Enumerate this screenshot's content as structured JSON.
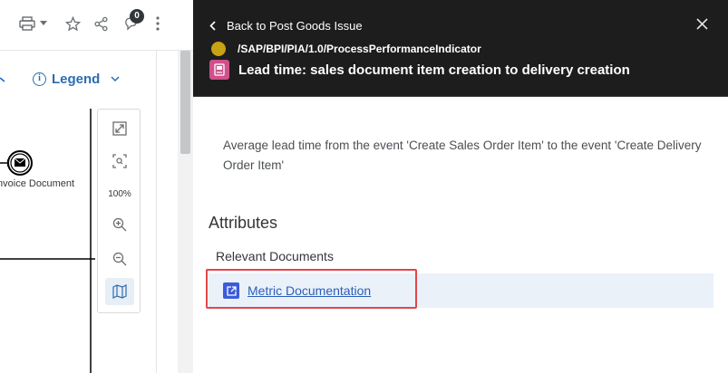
{
  "toolbar": {
    "icons": [
      "printer-icon",
      "caret-down-icon",
      "star-icon",
      "share-icon",
      "notifications-icon",
      "more-icon"
    ],
    "notification_count": "0"
  },
  "legend": {
    "label": "Legend",
    "icon": "info-icon"
  },
  "diagram": {
    "node_label": "Invoice Document",
    "node_icon": "envelope-icon"
  },
  "zoom_panel": {
    "zoom_level": "100%",
    "icons": [
      "fit-to-screen-icon",
      "zoom-to-selection-icon",
      "zoom-in-icon",
      "zoom-out-icon",
      "map-icon"
    ]
  },
  "detail": {
    "back_label": "Back to Post Goods Issue",
    "object_path": "/SAP/BPI/PIA/1.0/ProcessPerformanceIndicator",
    "title": "Lead time: sales document item creation to delivery creation",
    "description": "Average lead time from the event 'Create Sales Order Item' to the event 'Create Delivery Order Item'",
    "attributes_heading": "Attributes",
    "relevant_documents_label": "Relevant Documents",
    "document_link": "Metric Documentation"
  },
  "colors": {
    "header_bg": "#1d1d1d",
    "status_dot": "#c6a312",
    "title_icon_bg": "#d0508a",
    "link": "#2b5fb8",
    "highlight": "#e0464a",
    "row_highlight": "#eaf1f9"
  }
}
